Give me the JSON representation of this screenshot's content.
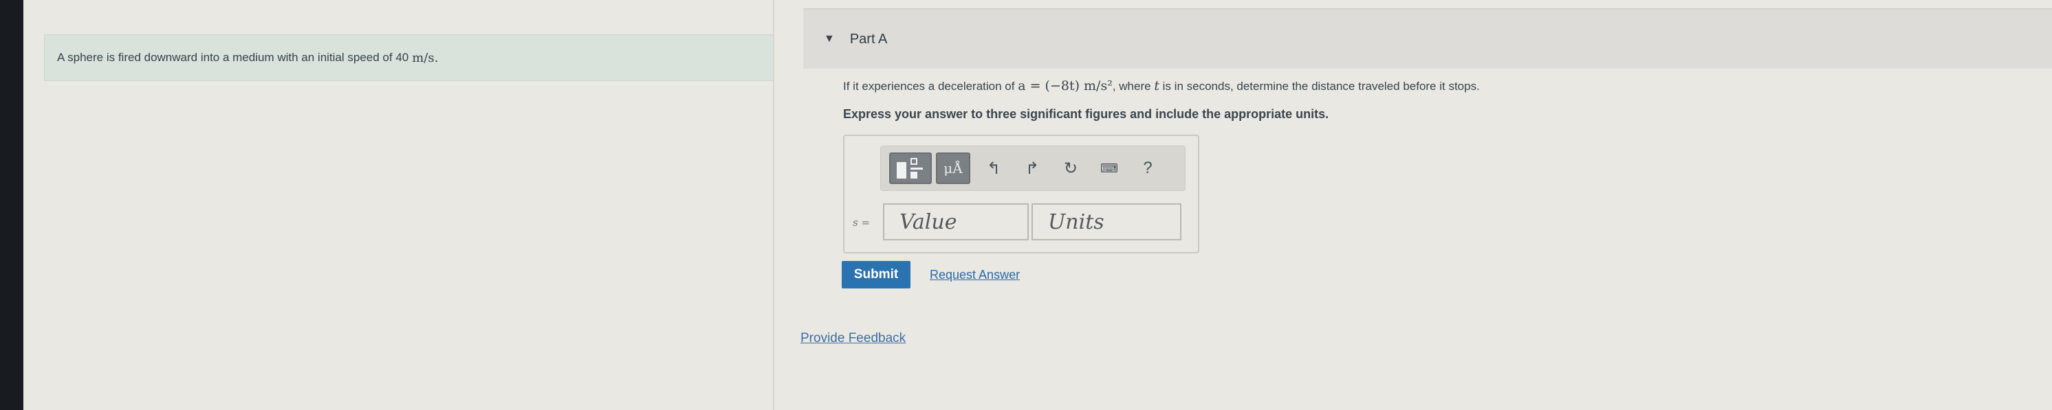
{
  "problem": {
    "text": "A sphere is fired downward into a medium with an initial speed of 40",
    "unit": "m/s."
  },
  "part": {
    "caret_icon": "caret-down-icon",
    "title": "Part A"
  },
  "question": {
    "pre": "If it experiences a deceleration of ",
    "math": "a = (−8t) m/s²",
    "mid": ", where ",
    "var": "t",
    "post": " is in seconds, determine the distance traveled before it stops."
  },
  "instruction": "Express your answer to three significant figures and include the appropriate units.",
  "toolbar": {
    "mu_label": "μÅ",
    "undo_icon": "undo-icon",
    "redo_icon": "redo-icon",
    "reset_icon": "reset-icon",
    "keyboard_icon": "keyboard-icon",
    "help_label": "?"
  },
  "answer": {
    "label": "s =",
    "value_placeholder": "Value",
    "units_placeholder": "Units"
  },
  "actions": {
    "submit_label": "Submit",
    "request_label": "Request Answer"
  },
  "feedback_label": "Provide Feedback",
  "colors": {
    "submit": "#2a72b0",
    "link": "#2d69a6",
    "problem_bg": "#d9e3dc"
  }
}
